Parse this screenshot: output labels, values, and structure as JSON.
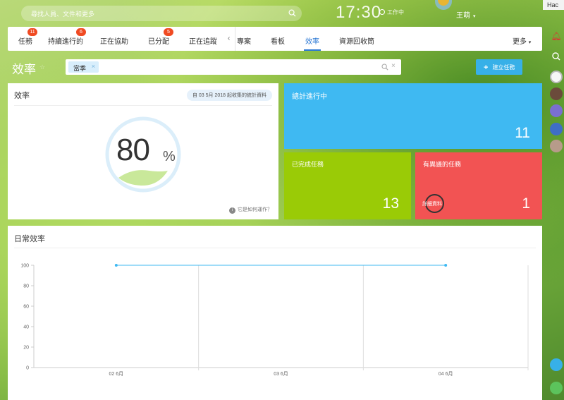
{
  "topbar": {
    "search_placeholder": "尋找人員、文件和更多",
    "clock": "17:30",
    "clock_status": "工作中",
    "user_name": "王萌",
    "right_popup": "Hac"
  },
  "nav": {
    "items": [
      {
        "label": "任務",
        "badge": "11"
      },
      {
        "label": "持續進行的",
        "badge": "6"
      },
      {
        "label": "正在協助",
        "badge": ""
      },
      {
        "label": "已分配",
        "badge": "5"
      },
      {
        "label": "正在追蹤",
        "badge": ""
      },
      {
        "label": "專案",
        "badge": ""
      },
      {
        "label": "看板",
        "badge": ""
      },
      {
        "label": "效率",
        "badge": ""
      },
      {
        "label": "資源回收筒",
        "badge": ""
      }
    ],
    "more": "更多",
    "scroll_arrow": "‹"
  },
  "filter": {
    "page_title": "效率",
    "chip": "當季",
    "chip_remove": "×",
    "clear": "×",
    "create_button": "建立任務"
  },
  "efficiency": {
    "title": "效率",
    "stats_since": "自 03 5月 2018 起收集的統計資料",
    "value": "80",
    "unit": "%",
    "help": "它是如何運作？"
  },
  "tiles": {
    "in_progress": {
      "title": "總計進行中",
      "count": "11"
    },
    "completed": {
      "title": "已完成任務",
      "count": "13"
    },
    "objections": {
      "title": "有異議的任務",
      "count": "1",
      "detail": "詳細資料"
    }
  },
  "daily": {
    "title": "日常效率"
  },
  "chart_data": {
    "type": "line",
    "title": "",
    "x": [
      "02 6月",
      "03 6月",
      "04 6月"
    ],
    "series": [
      {
        "values": [
          100,
          null,
          100
        ]
      }
    ],
    "yticks": [
      0,
      20,
      40,
      60,
      80,
      100
    ],
    "ylim": [
      0,
      100
    ],
    "grid": true,
    "color": "#3fb9f2"
  }
}
